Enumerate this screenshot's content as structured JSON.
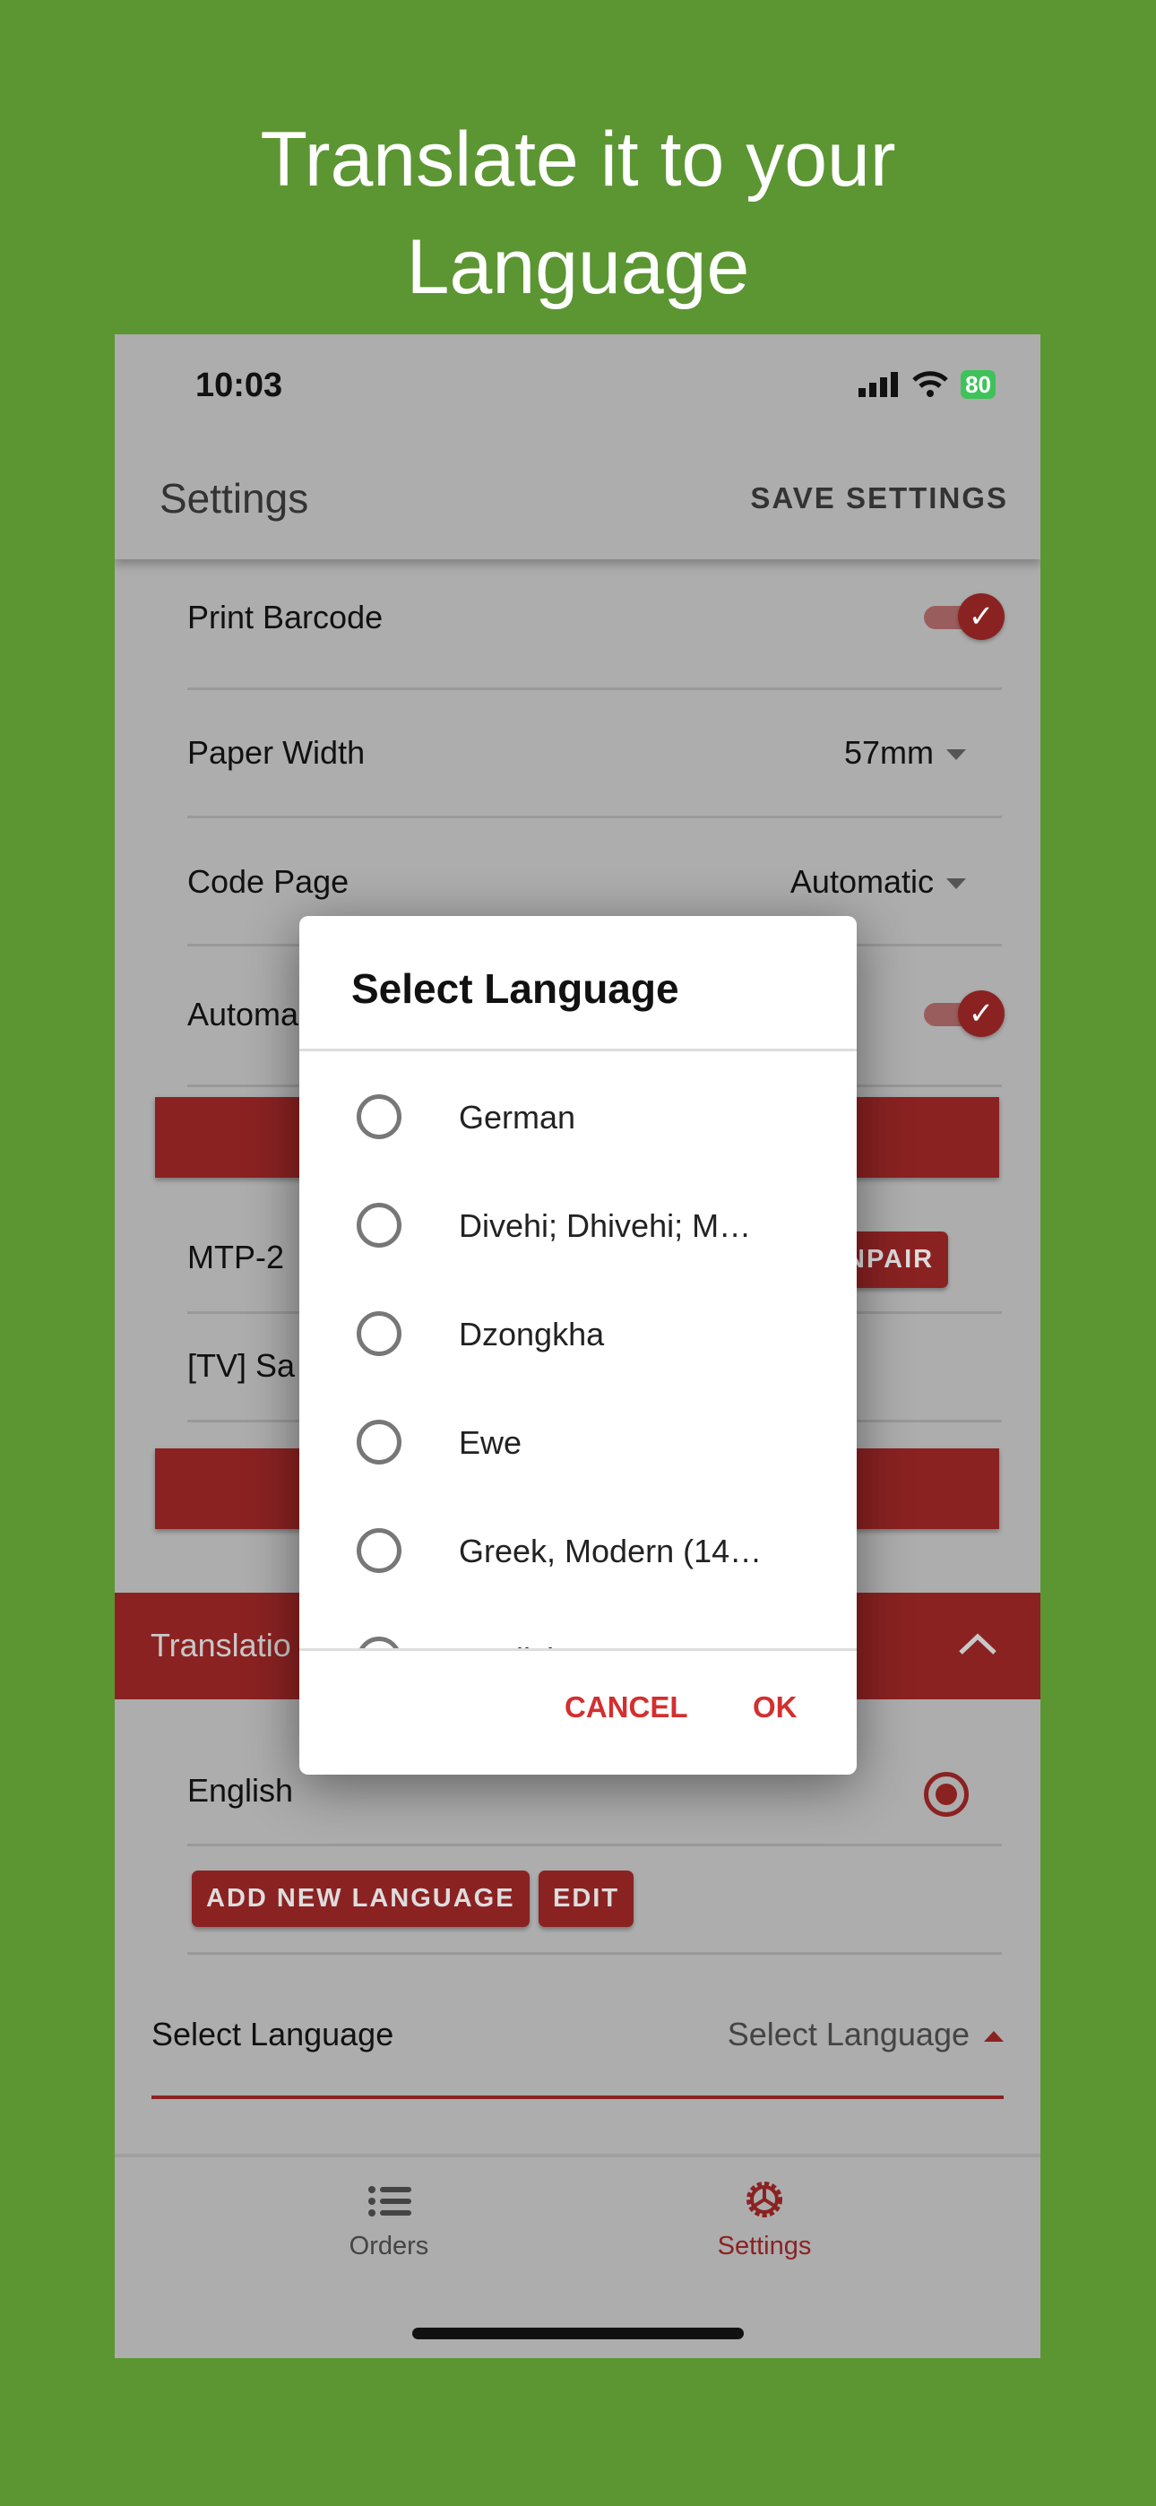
{
  "promo": {
    "line1": "Translate it to your",
    "line2": "Language"
  },
  "status_bar": {
    "time": "10:03",
    "battery": "80"
  },
  "header": {
    "title": "Settings",
    "save_label": "SAVE SETTINGS"
  },
  "settings": {
    "print_barcode": {
      "label": "Print Barcode",
      "enabled": true
    },
    "paper_width": {
      "label": "Paper Width",
      "value": "57mm"
    },
    "code_page": {
      "label": "Code Page",
      "value": "Automatic"
    },
    "auto": {
      "label": "Automa",
      "enabled": true
    },
    "printers": [
      {
        "name": "MTP-2",
        "action": "NPAIR"
      },
      {
        "name": "[TV] Sa"
      }
    ]
  },
  "translations": {
    "section_title": "Translatio",
    "languages": [
      {
        "name": "English",
        "selected": true
      }
    ],
    "add_label": "ADD NEW LANGUAGE",
    "edit_label": "EDIT",
    "select_label": "Select Language",
    "select_placeholder": "Select Language"
  },
  "dialog": {
    "title": "Select Language",
    "options": [
      "German",
      "Divehi; Dhivehi; M…",
      "Dzongkha",
      "Ewe",
      "Greek, Modern (14…",
      "English"
    ],
    "cancel_label": "CANCEL",
    "ok_label": "OK"
  },
  "nav": {
    "items": [
      {
        "label": "Orders",
        "icon": "list-icon"
      },
      {
        "label": "Settings",
        "icon": "gear-icon",
        "active": true
      }
    ]
  },
  "colors": {
    "background": "#5c9633",
    "accent": "#d32f2f",
    "dimmed_accent": "#8b2222"
  }
}
